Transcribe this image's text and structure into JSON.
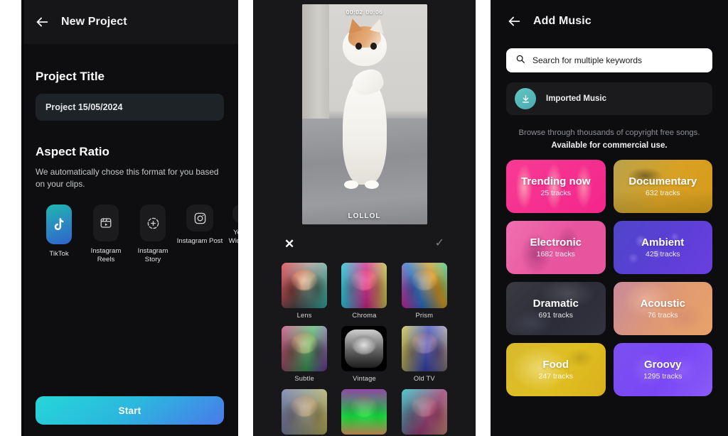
{
  "panels": {
    "new_project": {
      "appbar": {
        "title": "New Project",
        "back_icon": "back-arrow-icon"
      },
      "project_title": {
        "heading": "Project Title",
        "value": "Project 15/05/2024"
      },
      "aspect_ratio": {
        "heading": "Aspect Ratio",
        "description": "We automatically chose this format for you based on your clips.",
        "options": [
          {
            "label": "TikTok",
            "icon": "tiktok-icon",
            "selected": true
          },
          {
            "label": "Instagram Reels",
            "icon": "instagram-reels-icon",
            "selected": false
          },
          {
            "label": "Instagram Story",
            "icon": "instagram-story-icon",
            "selected": false
          },
          {
            "label": "Instagram Post",
            "icon": "instagram-post-icon",
            "selected": false
          },
          {
            "label": "YouTube Widescreen",
            "icon": "youtube-icon",
            "selected": false
          }
        ]
      },
      "start_button": {
        "label": "Start",
        "gradient_from": "#25d7d7",
        "gradient_to": "#4a79ea"
      }
    },
    "filters": {
      "preview": {
        "current_time": "00:02",
        "total_time": "00:06",
        "caption": "LOLLOL"
      },
      "toolbar": {
        "cancel_icon": "close-icon",
        "confirm_icon": "check-icon"
      },
      "items": [
        {
          "label": "Lens",
          "style": "ft-lens"
        },
        {
          "label": "Chroma",
          "style": "ft-chroma"
        },
        {
          "label": "Prism",
          "style": "ft-prism"
        },
        {
          "label": "Subtle",
          "style": "ft-subtle"
        },
        {
          "label": "Vintage",
          "style": "ft-vintage"
        },
        {
          "label": "Old TV",
          "style": "ft-oldtv"
        }
      ]
    },
    "add_music": {
      "appbar": {
        "title": "Add Music",
        "back_icon": "back-arrow-icon"
      },
      "search": {
        "placeholder": "Search for multiple keywords",
        "icon": "search-icon"
      },
      "imported": {
        "label": "Imported Music",
        "icon": "download-icon",
        "circle_color": "#63c7c4"
      },
      "blurb": {
        "line1": "Browse through thousands of copyright free songs.",
        "line2": "Available for commercial use."
      },
      "genres": [
        {
          "name": "Trending now",
          "count": "25 tracks",
          "color": "#f3268b"
        },
        {
          "name": "Documentary",
          "count": "632 tracks",
          "color": "#d9a123"
        },
        {
          "name": "Electronic",
          "count": "1682 tracks",
          "color": "#e8559f"
        },
        {
          "name": "Ambient",
          "count": "425 tracks",
          "color": "#5b3fd6"
        },
        {
          "name": "Dramatic",
          "count": "691 tracks",
          "color": "#2c2c38"
        },
        {
          "name": "Acoustic",
          "count": "76 tracks",
          "color": "#e09a72"
        },
        {
          "name": "Food",
          "count": "247 tracks",
          "color": "#e0bf22"
        },
        {
          "name": "Groovy",
          "count": "1295 tracks",
          "color": "#7a47f5"
        }
      ]
    }
  }
}
